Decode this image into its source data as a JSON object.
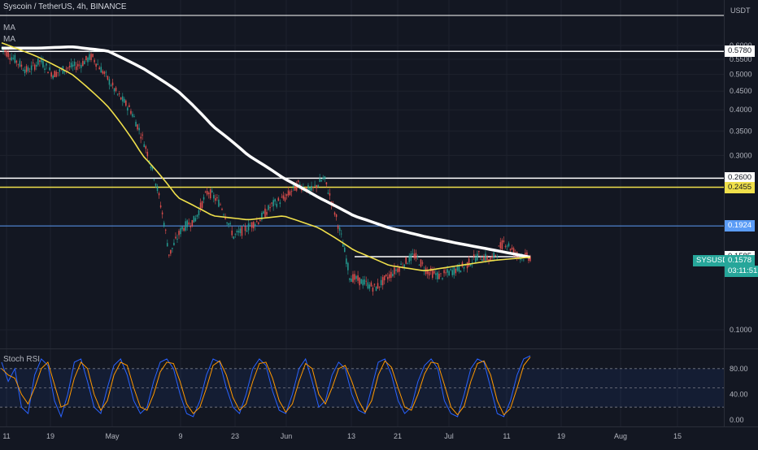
{
  "header": {
    "symbol_line": "Syscoin / TetherUS, 4h, BINANCE",
    "indicator_1": "MA",
    "indicator_2": "MA",
    "currency": "USDT"
  },
  "chart_data": [
    {
      "type": "line",
      "xlabel": "",
      "ylabel": "",
      "x_ticks": [
        "11",
        "19",
        "May",
        "9",
        "23",
        "Jun",
        "13",
        "21",
        "Jul",
        "11",
        "19",
        "Aug",
        "15"
      ],
      "y_ticks": [
        "0.6000",
        "0.5500",
        "0.5000",
        "0.4500",
        "0.4000",
        "0.3500",
        "0.3000",
        "0.1000"
      ],
      "log_scale": true,
      "grid": true,
      "price_series": {
        "approx_path": [
          0.59,
          0.55,
          0.51,
          0.545,
          0.5,
          0.52,
          0.53,
          0.56,
          0.5,
          0.44,
          0.4,
          0.33,
          0.25,
          0.16,
          0.19,
          0.2,
          0.24,
          0.22,
          0.18,
          0.19,
          0.2,
          0.22,
          0.23,
          0.25,
          0.24,
          0.26,
          0.2,
          0.14,
          0.135,
          0.13,
          0.14,
          0.15,
          0.16,
          0.145,
          0.14,
          0.145,
          0.15,
          0.16,
          0.155,
          0.175,
          0.16,
          0.1578
        ]
      },
      "moving_averages": [
        {
          "color": "#ffffff",
          "approx_path": [
            0.59,
            0.59,
            0.595,
            0.58,
            0.52,
            0.45,
            0.36,
            0.3,
            0.26,
            0.23,
            0.205,
            0.19,
            0.18,
            0.172,
            0.165,
            0.158
          ]
        },
        {
          "color": "#f0e04b",
          "approx_path": [
            0.61,
            0.56,
            0.5,
            0.41,
            0.3,
            0.23,
            0.205,
            0.2,
            0.205,
            0.19,
            0.165,
            0.15,
            0.145,
            0.15,
            0.155,
            0.158
          ]
        }
      ],
      "horizontal_levels": [
        {
          "label": "0.5780",
          "value": 0.578,
          "color": "#ffffff"
        },
        {
          "label": "0.2600",
          "value": 0.26,
          "color": "#ffffff"
        },
        {
          "label": "0.2455",
          "value": 0.2455,
          "color": "#f0e04b"
        },
        {
          "label": "0.1924",
          "value": 0.1924,
          "color": "#5b9cf6"
        },
        {
          "label": "0.1585",
          "value": 0.1585,
          "color": "#ffffff"
        }
      ],
      "last_price": {
        "symbol": "SYSUSDT",
        "value": "0.1578",
        "countdown": "03:11:51",
        "color": "#26a69a"
      }
    },
    {
      "type": "line",
      "title": "Stoch RSI",
      "xlabel": "",
      "ylabel": "",
      "y_ticks": [
        "80.00",
        "40.00",
        "0.00"
      ],
      "ylim": [
        0,
        100
      ],
      "bands": [
        80,
        50,
        20
      ],
      "k_series": {
        "name": "",
        "color": "#2962ff",
        "values": [
          90,
          60,
          80,
          20,
          10,
          70,
          95,
          85,
          30,
          5,
          40,
          90,
          95,
          60,
          20,
          10,
          50,
          85,
          95,
          70,
          30,
          10,
          20,
          60,
          90,
          95,
          80,
          40,
          10,
          5,
          30,
          70,
          95,
          90,
          50,
          20,
          10,
          40,
          80,
          95,
          85,
          45,
          15,
          10,
          40,
          80,
          95,
          60,
          20,
          30,
          70,
          90,
          80,
          40,
          15,
          10,
          50,
          90,
          95,
          70,
          30,
          10,
          20,
          60,
          85,
          95,
          80,
          30,
          10,
          5,
          40,
          80,
          95,
          90,
          50,
          10,
          5,
          30,
          70,
          95,
          100
        ]
      },
      "d_series": {
        "name": "",
        "color": "#ff9800",
        "values": [
          80,
          70,
          65,
          40,
          25,
          50,
          80,
          90,
          55,
          20,
          25,
          65,
          90,
          80,
          40,
          15,
          30,
          70,
          90,
          85,
          50,
          20,
          15,
          40,
          75,
          90,
          88,
          60,
          25,
          10,
          20,
          50,
          85,
          92,
          70,
          35,
          15,
          25,
          60,
          88,
          90,
          65,
          30,
          12,
          25,
          60,
          88,
          80,
          40,
          25,
          50,
          80,
          85,
          60,
          30,
          12,
          30,
          70,
          92,
          82,
          50,
          20,
          15,
          40,
          72,
          90,
          88,
          55,
          20,
          8,
          22,
          60,
          88,
          92,
          70,
          30,
          8,
          18,
          50,
          85,
          98
        ]
      }
    }
  ]
}
